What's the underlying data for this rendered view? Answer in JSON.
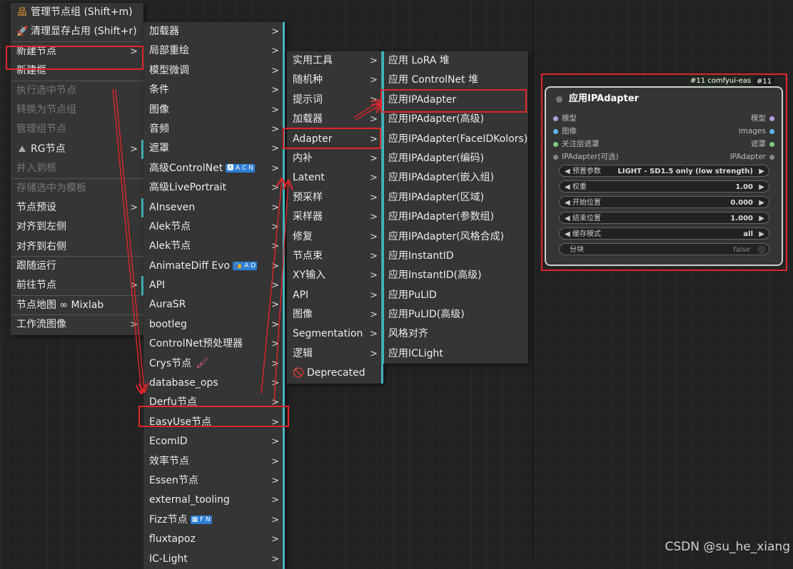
{
  "menu1": [
    {
      "label": "管理节点组 (Shift+m)",
      "icon": "group-icon"
    },
    {
      "label": "清理显存占用 (Shift+r)",
      "icon": "rocket-icon"
    },
    {
      "label": "新建节点",
      "arrow": true
    },
    {
      "label": "新建框"
    },
    {
      "label": "执行选中节点",
      "disabled": true
    },
    {
      "label": "转换为节点组",
      "disabled": true
    },
    {
      "label": "管理组节点",
      "disabled": true
    },
    {
      "label": "RG节点",
      "arrow": true,
      "icon": "rg-icon"
    },
    {
      "label": "并入到框",
      "disabled": true
    },
    {
      "label": "存储选中为模板",
      "disabled": true
    },
    {
      "label": "节点预设",
      "arrow": true
    },
    {
      "label": "对齐到左侧"
    },
    {
      "label": "对齐到右侧"
    },
    {
      "label": "跟随运行"
    },
    {
      "label": "前往节点",
      "arrow": true
    },
    {
      "label": "节点地图 ∞ Mixlab"
    },
    {
      "label": "工作流图像",
      "arrow": true
    }
  ],
  "menu2": [
    "加载器",
    "局部重绘",
    "模型微调",
    "条件",
    "图像",
    "音频",
    "遮罩",
    "高级ControlNet",
    "高级LivePortrait",
    "AInseven",
    "Alek节点",
    "Alek节点",
    "AnimateDiff Evo",
    "API",
    "AuraSR",
    "bootleg",
    "ControlNet预处理器",
    "Crys节点",
    "database_ops",
    "Derfu节点",
    "EasyUse节点",
    "EcomID",
    "效率节点",
    "Essen节点",
    "external_tooling",
    "Fizz节点",
    "fluxtapoz",
    "IC-Light"
  ],
  "menu2_badges": {
    "advcn": "🆇 A C N",
    "animdiff": "🎭 A D",
    "fizz": "▦ F N"
  },
  "menu3": [
    "实用工具",
    "随机种",
    "提示词",
    "加载器",
    "Adapter",
    "内补",
    "Latent",
    "预采样",
    "采样器",
    "修复",
    "节点束",
    "XY输入",
    "API",
    "图像",
    "Segmentation",
    "逻辑",
    "Deprecated"
  ],
  "menu4": [
    "应用 LoRA 堆",
    "应用 ControlNet 堆",
    "应用IPAdapter",
    "应用IPAdapter(高级)",
    "应用IPAdapter(FaceIDKolors)",
    "应用IPAdapter(编码)",
    "应用IPAdapter(嵌入组)",
    "应用IPAdapter(区域)",
    "应用IPAdapter(参数组)",
    "应用IPAdapter(风格合成)",
    "应用InstantID",
    "应用InstantID(高级)",
    "应用PuLID",
    "应用PuLID(高级)",
    "风格对齐",
    "应用ICLight"
  ],
  "node": {
    "title": "应用IPAdapter",
    "badge_left": "#11 comfyui-eas",
    "badge_right": "#11",
    "inputs": [
      {
        "label": "模型",
        "color": "#b39ddb"
      },
      {
        "label": "图像",
        "color": "#64b5f6"
      },
      {
        "label": "关注层遮罩",
        "color": "#81c784"
      },
      {
        "label": "IPAdapter(可选)",
        "color": "#888888"
      }
    ],
    "outputs": [
      {
        "label": "模型",
        "color": "#b39ddb"
      },
      {
        "label": "images",
        "color": "#64b5f6"
      },
      {
        "label": "遮罩",
        "color": "#81c784"
      },
      {
        "label": "IPAdapter",
        "color": "#888888"
      }
    ],
    "widgets": [
      {
        "label": "预置参数",
        "value": "LIGHT - SD1.5 only (low strength)"
      },
      {
        "label": "权重",
        "value": "1.00"
      },
      {
        "label": "开始位置",
        "value": "0.000"
      },
      {
        "label": "结束位置",
        "value": "1.000"
      },
      {
        "label": "缓存模式",
        "value": "all"
      },
      {
        "label": "分块",
        "value": "false"
      }
    ]
  },
  "watermark": "CSDN @su_he_xiang",
  "colors": {
    "highlight": "#e0262b",
    "accent": "#41b8c2"
  }
}
